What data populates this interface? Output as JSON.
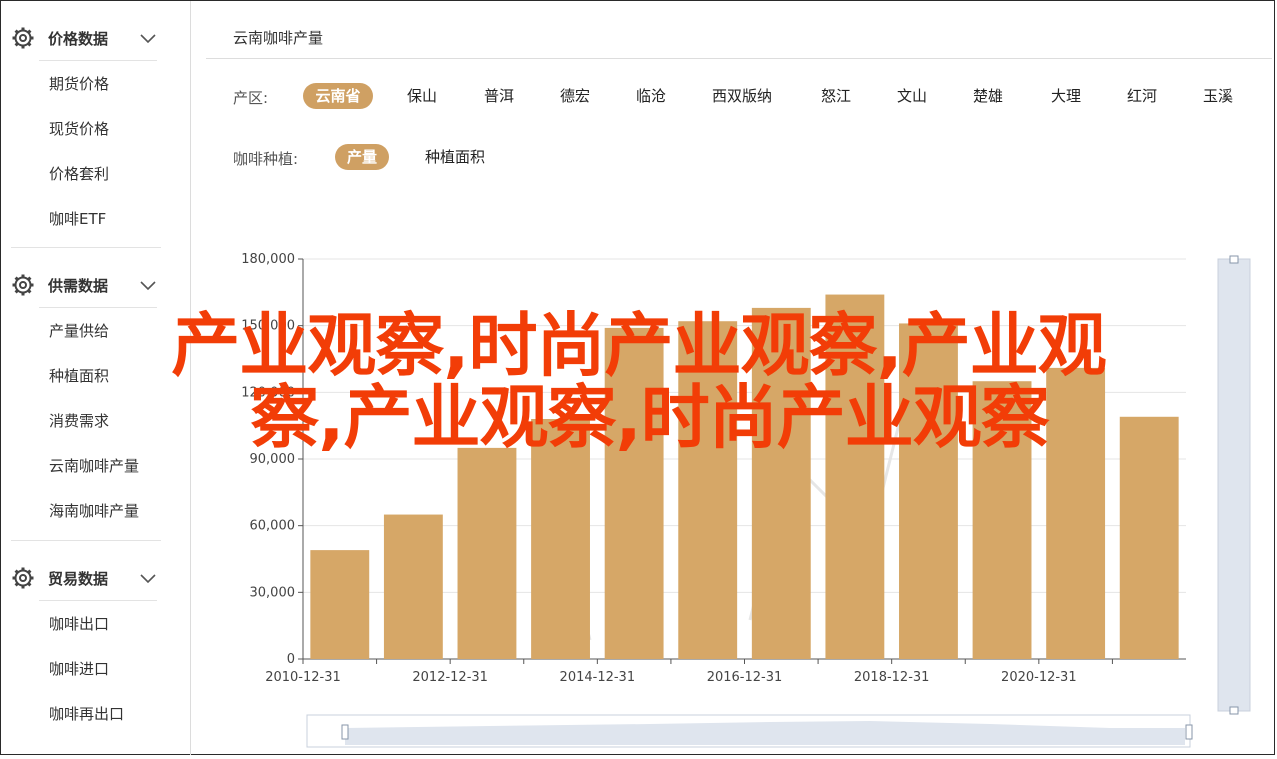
{
  "sidebar": {
    "sections": [
      {
        "title": "价格数据",
        "items": [
          "期货价格",
          "现货价格",
          "价格套利",
          "咖啡ETF"
        ]
      },
      {
        "title": "供需数据",
        "items": [
          "产量供给",
          "种植面积",
          "消费需求",
          "云南咖啡产量",
          "海南咖啡产量"
        ]
      },
      {
        "title": "贸易数据",
        "items": [
          "咖啡出口",
          "咖啡进口",
          "咖啡再出口"
        ]
      }
    ]
  },
  "main": {
    "title": "云南咖啡产量",
    "region_label": "产区:",
    "regions": [
      "云南省",
      "保山",
      "普洱",
      "德宏",
      "临沧",
      "西双版纳",
      "怒江",
      "文山",
      "楚雄",
      "大理",
      "红河",
      "玉溪"
    ],
    "region_active": 0,
    "metric_label": "咖啡种植:",
    "metrics": [
      "产量",
      "种植面积"
    ],
    "metric_active": 0
  },
  "overlay_text": {
    "line1": "产业观察,时尚产业观察,产业观",
    "line2": "察,产业观察,时尚产业观察"
  },
  "colors": {
    "accent": "#cfa063",
    "bar": "#d6a767",
    "overlay": "#f23d07"
  },
  "chart_data": {
    "type": "bar",
    "categories": [
      "2010-12-31",
      "2011-12-31",
      "2012-12-31",
      "2013-12-31",
      "2014-12-31",
      "2015-12-31",
      "2016-12-31",
      "2017-12-31",
      "2018-12-31",
      "2019-12-31",
      "2020-12-31",
      "2021-12-31"
    ],
    "values": [
      49000,
      65000,
      95000,
      108000,
      149000,
      152000,
      158000,
      164000,
      151000,
      125000,
      131000,
      109000
    ],
    "x_tick_labels": [
      "2010-12-31",
      "2012-12-31",
      "2014-12-31",
      "2016-12-31",
      "2018-12-31",
      "2020-12-31"
    ],
    "y_ticks": [
      0,
      30000,
      60000,
      90000,
      120000,
      150000,
      180000
    ],
    "y_tick_labels": [
      "0",
      "30,000",
      "60,000",
      "90,000",
      "120,000",
      "150,000",
      "180,000"
    ],
    "ylim": [
      0,
      180000
    ],
    "grid": true,
    "title": "",
    "xlabel": "",
    "ylabel": ""
  }
}
